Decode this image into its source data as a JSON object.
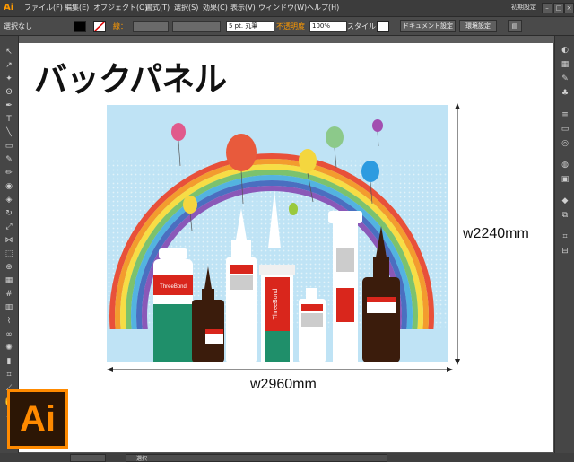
{
  "app": {
    "logo_text": "Ai"
  },
  "menu": {
    "items": [
      "ファイル(F)",
      "編集(E)",
      "オブジェクト(O)",
      "書式(T)",
      "選択(S)",
      "効果(C)",
      "表示(V)",
      "ウィンドウ(W)",
      "ヘルプ(H)"
    ],
    "workspace": "初期設定"
  },
  "control": {
    "no_selection": "選択なし",
    "stroke_label": "線：",
    "brush": "5 pt. 丸筆",
    "opacity_label": "不透明度",
    "opacity_value": "100%",
    "style_label": "スタイル：",
    "doc_setup": "ドキュメント設定",
    "prefs": "環境設定"
  },
  "artboard": {
    "title": "バックパネル",
    "width_label": "w2960mm",
    "height_label": "w2240mm",
    "bottle_brand": "ThreeBond"
  },
  "status": {
    "zoom": "",
    "mode": "選択"
  },
  "colors": {
    "accent": "#ff9a00",
    "sky": "#bfe3f5",
    "bottle_green": "#1f8f6a",
    "bottle_red": "#d9261c",
    "bottle_brown": "#3b1c0c"
  }
}
